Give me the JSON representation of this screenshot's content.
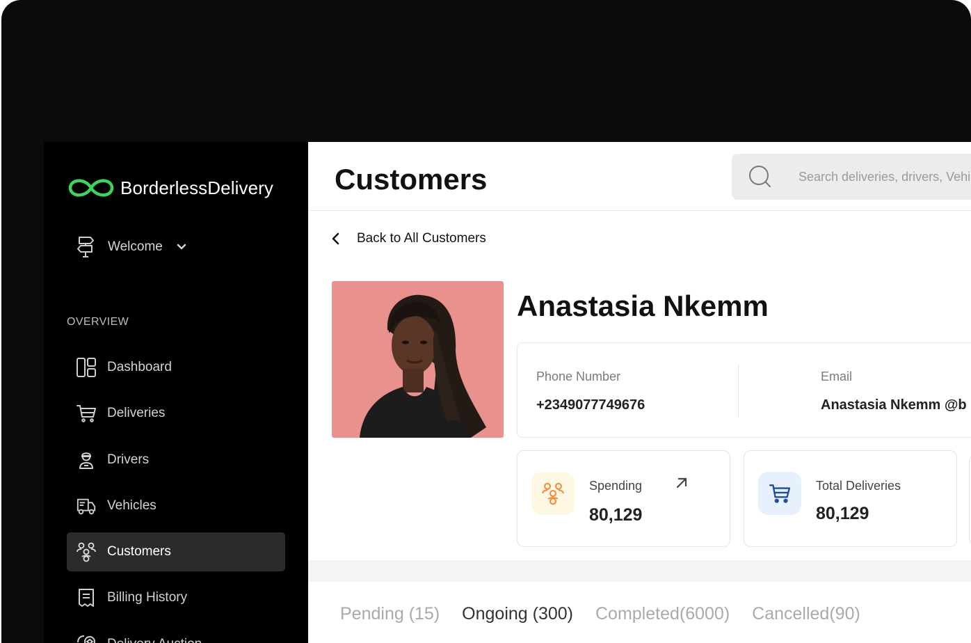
{
  "brand": {
    "name": "BorderlessDelivery",
    "accent_color": "#3ed35c"
  },
  "sidebar": {
    "welcome_label": "Welcome",
    "section_label": "OVERVIEW",
    "items": [
      {
        "label": "Dashboard",
        "icon": "dashboard-icon"
      },
      {
        "label": "Deliveries",
        "icon": "cart-icon"
      },
      {
        "label": "Drivers",
        "icon": "driver-icon"
      },
      {
        "label": "Vehicles",
        "icon": "truck-icon"
      },
      {
        "label": "Customers",
        "icon": "customers-icon",
        "active": true
      },
      {
        "label": "Billing History",
        "icon": "receipt-icon"
      },
      {
        "label": "Delivery Auction",
        "icon": "auction-icon"
      }
    ]
  },
  "header": {
    "title": "Customers",
    "search_placeholder": "Search deliveries, drivers, Vehicles"
  },
  "back_link": "Back to All Customers",
  "customer": {
    "name": "Anastasia Nkemm",
    "phone_label": "Phone Number",
    "phone_value": "+2349077749676",
    "email_label": "Email",
    "email_value": "Anastasia Nkemm @b"
  },
  "stats": [
    {
      "label": "Spending",
      "value": "80,129",
      "icon": "customers-icon",
      "icon_bg": "#fdf8e4",
      "icon_color": "#f28a3a"
    },
    {
      "label": "Total Deliveries",
      "value": "80,129",
      "icon": "cart-icon",
      "icon_bg": "#e7f0fd",
      "icon_color": "#1f4f9c"
    }
  ],
  "tabs": [
    {
      "label": "Pending (15)"
    },
    {
      "label": "Ongoing (300)",
      "active": true
    },
    {
      "label": "Completed(6000)"
    },
    {
      "label": "Cancelled(90)"
    }
  ]
}
